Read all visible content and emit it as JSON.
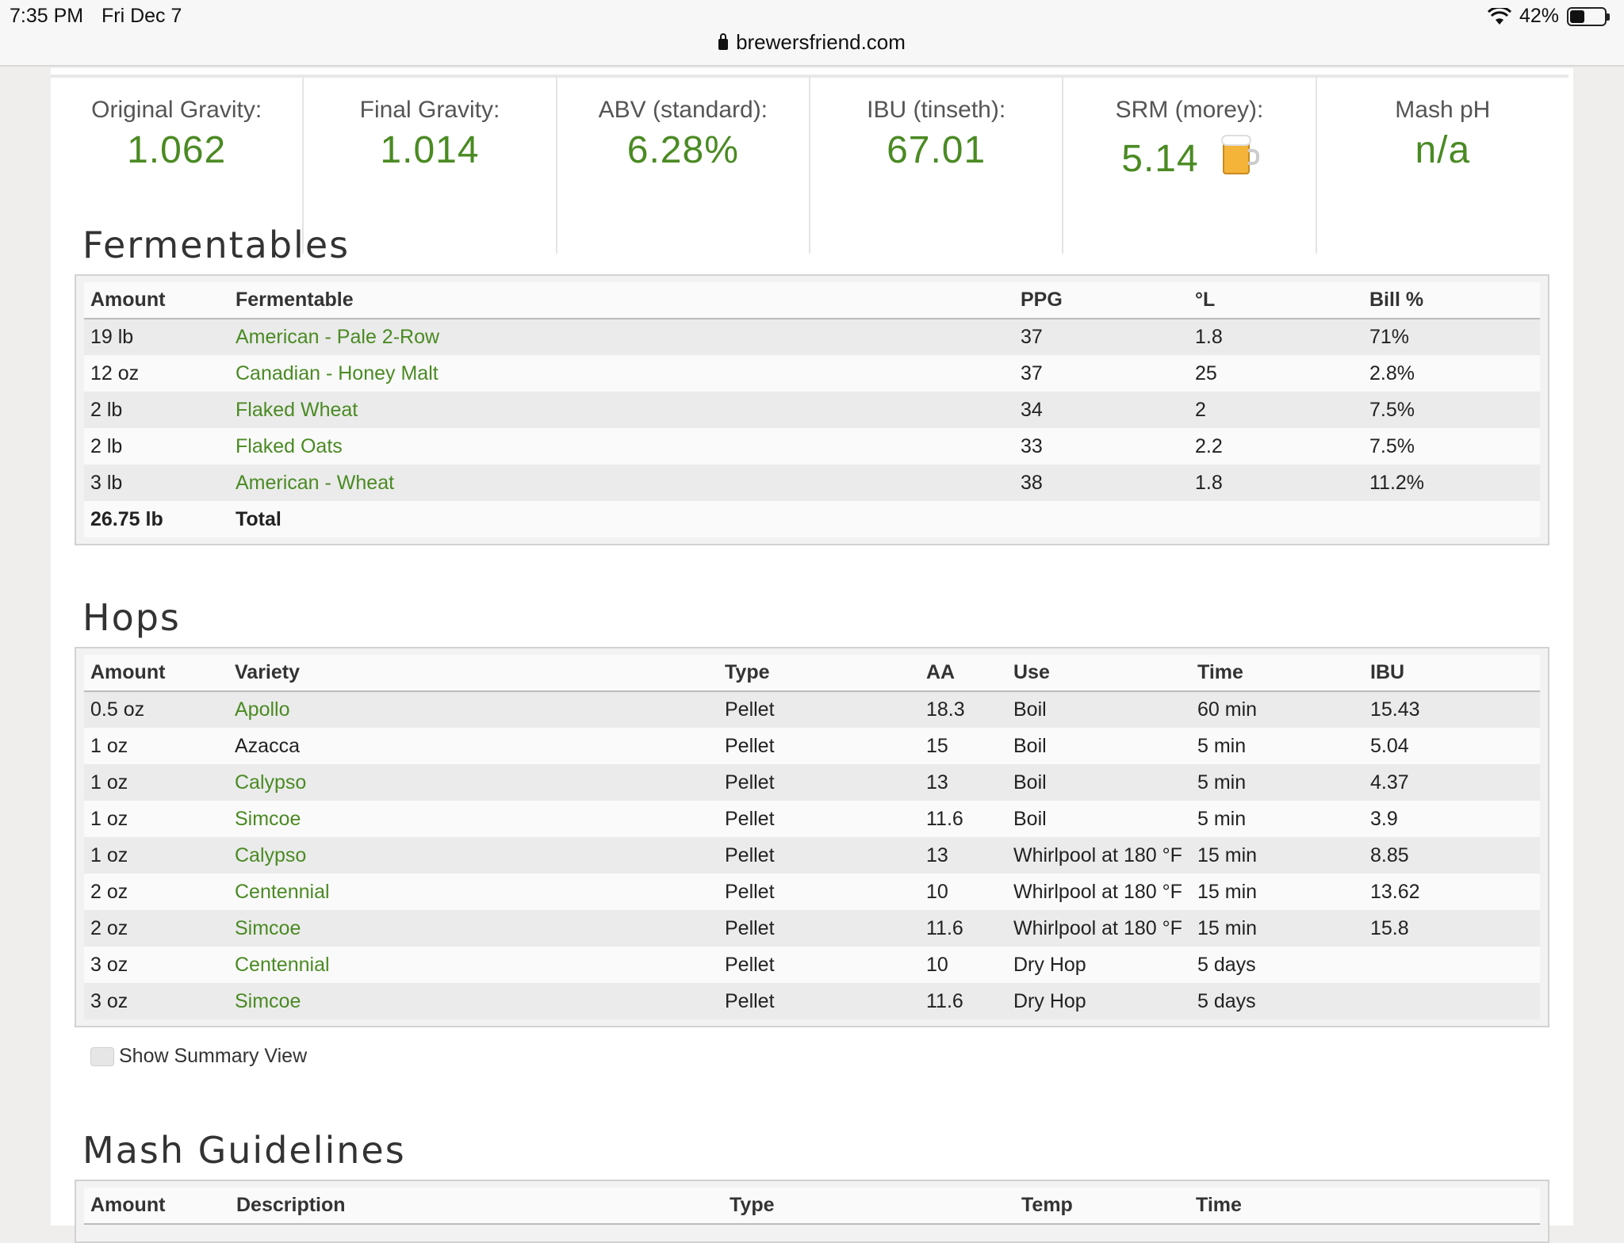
{
  "status_bar": {
    "time": "7:35 PM",
    "date": "Fri Dec 7",
    "battery": "42%",
    "url": "brewersfriend.com"
  },
  "stats": [
    {
      "label": "Original Gravity:",
      "value": "1.062"
    },
    {
      "label": "Final Gravity:",
      "value": "1.014"
    },
    {
      "label": "ABV (standard):",
      "value": "6.28%"
    },
    {
      "label": "IBU (tinseth):",
      "value": "67.01"
    },
    {
      "label": "SRM (morey):",
      "value": "5.14"
    },
    {
      "label": "Mash pH",
      "value": "n/a"
    }
  ],
  "fermentables": {
    "title": "Fermentables",
    "headers": [
      "Amount",
      "Fermentable",
      "PPG",
      "°L",
      "Bill %"
    ],
    "rows": [
      {
        "amount": "19 lb",
        "name": "American - Pale 2-Row",
        "ppg": "37",
        "lovibond": "1.8",
        "bill": "71%"
      },
      {
        "amount": "12 oz",
        "name": "Canadian - Honey Malt",
        "ppg": "37",
        "lovibond": "25",
        "bill": "2.8%"
      },
      {
        "amount": "2 lb",
        "name": "Flaked Wheat",
        "ppg": "34",
        "lovibond": "2",
        "bill": "7.5%"
      },
      {
        "amount": "2 lb",
        "name": "Flaked Oats",
        "ppg": "33",
        "lovibond": "2.2",
        "bill": "7.5%"
      },
      {
        "amount": "3 lb",
        "name": "American - Wheat",
        "ppg": "38",
        "lovibond": "1.8",
        "bill": "11.2%"
      }
    ],
    "total": {
      "amount": "26.75 lb",
      "label": "Total"
    }
  },
  "hops": {
    "title": "Hops",
    "headers": [
      "Amount",
      "Variety",
      "Type",
      "AA",
      "Use",
      "Time",
      "IBU"
    ],
    "rows": [
      {
        "amount": "0.5 oz",
        "variety": "Apollo",
        "type": "Pellet",
        "aa": "18.3",
        "use": "Boil",
        "time": "60 min",
        "ibu": "15.43"
      },
      {
        "amount": "1 oz",
        "variety": "Azacca",
        "type": "Pellet",
        "aa": "15",
        "use": "Boil",
        "time": "5 min",
        "ibu": "5.04"
      },
      {
        "amount": "1 oz",
        "variety": "Calypso",
        "type": "Pellet",
        "aa": "13",
        "use": "Boil",
        "time": "5 min",
        "ibu": "4.37"
      },
      {
        "amount": "1 oz",
        "variety": "Simcoe",
        "type": "Pellet",
        "aa": "11.6",
        "use": "Boil",
        "time": "5 min",
        "ibu": "3.9"
      },
      {
        "amount": "1 oz",
        "variety": "Calypso",
        "type": "Pellet",
        "aa": "13",
        "use": "Whirlpool at 180 °F",
        "time": "15 min",
        "ibu": "8.85"
      },
      {
        "amount": "2 oz",
        "variety": "Centennial",
        "type": "Pellet",
        "aa": "10",
        "use": "Whirlpool at 180 °F",
        "time": "15 min",
        "ibu": "13.62"
      },
      {
        "amount": "2 oz",
        "variety": "Simcoe",
        "type": "Pellet",
        "aa": "11.6",
        "use": "Whirlpool at 180 °F",
        "time": "15 min",
        "ibu": "15.8"
      },
      {
        "amount": "3 oz",
        "variety": "Centennial",
        "type": "Pellet",
        "aa": "10",
        "use": "Dry Hop",
        "time": "5 days",
        "ibu": ""
      },
      {
        "amount": "3 oz",
        "variety": "Simcoe",
        "type": "Pellet",
        "aa": "11.6",
        "use": "Dry Hop",
        "time": "5 days",
        "ibu": ""
      }
    ],
    "show_summary_label": "Show Summary View"
  },
  "mash": {
    "title": "Mash Guidelines",
    "headers": [
      "Amount",
      "Description",
      "Type",
      "Temp",
      "Time"
    ]
  },
  "colors": {
    "accent_green": "#4a8a23"
  }
}
